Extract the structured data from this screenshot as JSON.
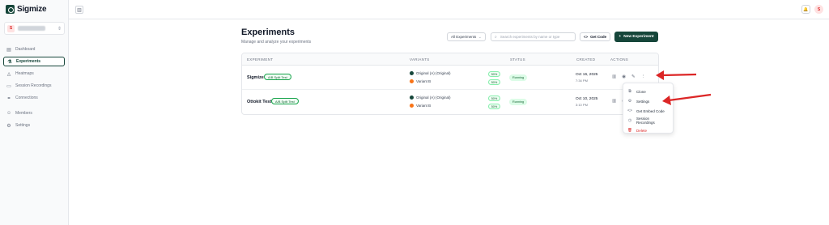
{
  "app": {
    "name": "Sigmize"
  },
  "workspace": {
    "avatar": "S",
    "chevron": "⇕"
  },
  "sidebar": {
    "items": [
      {
        "label": "Dashboard",
        "icon": "▤",
        "name": "sidebar-item-dashboard"
      },
      {
        "label": "Experiments",
        "icon": "⚗",
        "name": "sidebar-item-experiments",
        "active": true
      },
      {
        "label": "Heatmaps",
        "icon": "◬",
        "name": "sidebar-item-heatmaps"
      },
      {
        "label": "Session Recordings",
        "icon": "▭",
        "name": "sidebar-item-session-recordings"
      },
      {
        "label": "Connections",
        "icon": "⚭",
        "name": "sidebar-item-connections"
      },
      {
        "label": "Members",
        "icon": "☺",
        "name": "sidebar-item-members"
      },
      {
        "label": "Settings",
        "icon": "⚙",
        "name": "sidebar-item-settings"
      }
    ]
  },
  "topbar": {
    "toggle_icon": "▥",
    "bell_icon": "🔔",
    "user_avatar": "S"
  },
  "main": {
    "title": "Experiments",
    "subtitle": "Manage and analyze your experiments",
    "filter": {
      "value": "All Experiments",
      "chevron": "⌄"
    },
    "search": {
      "placeholder": "Search experiments by name or type",
      "icon": "⌕"
    },
    "get_code": {
      "icon": "<>",
      "label": "Get Code"
    },
    "new_experiment": {
      "icon": "+",
      "label": "New Experiment"
    }
  },
  "table": {
    "headers": [
      "EXPERIMENT",
      "VARIANTS",
      "STATUS",
      "CREATED",
      "ACTIONS"
    ],
    "rows": [
      {
        "name": "Sigmize",
        "type": "A/B Split Test",
        "variants": [
          {
            "label": "Original (A) (Original)",
            "color": "#16463a",
            "pct": "50%"
          },
          {
            "label": "Variant B",
            "color": "#f97316",
            "pct": "50%"
          }
        ],
        "status": "Running",
        "date": "Oct 16, 2025",
        "time": "7:34 PM"
      },
      {
        "name": "Ottokit Test",
        "type": "A/B Split Test",
        "variants": [
          {
            "label": "Original (A) (Original)",
            "color": "#16463a",
            "pct": "50%"
          },
          {
            "label": "Variant B",
            "color": "#f97316",
            "pct": "50%"
          }
        ],
        "status": "Running",
        "date": "Oct 10, 2025",
        "time": "3:10 PM"
      }
    ],
    "action_icons": {
      "stats": "▥",
      "view": "◉",
      "edit": "✎",
      "more": "⋮"
    }
  },
  "menu": {
    "items": [
      {
        "label": "Clone",
        "icon": "⧉"
      },
      {
        "label": "Settings",
        "icon": "⚙"
      },
      {
        "label": "Get Embed Code",
        "icon": "<>"
      },
      {
        "label": "Session Recordings",
        "icon": "◷"
      },
      {
        "label": "Delete",
        "icon": "🗑",
        "danger": true
      }
    ]
  },
  "colors": {
    "brand": "#16463a",
    "arrow": "#dc2626",
    "variant_b": "#f97316"
  }
}
